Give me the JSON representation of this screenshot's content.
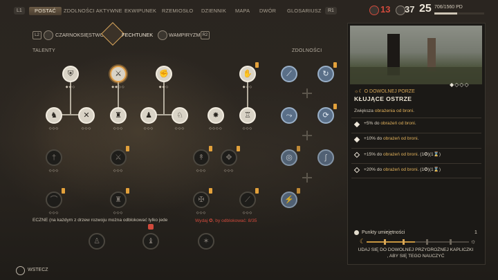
{
  "topbar": {
    "left_button": "L1",
    "right_button": "R1",
    "tabs": [
      {
        "label": "POSTAĆ",
        "active": true
      },
      {
        "label": "ZDOLNOŚCI AKTYWNE",
        "active": false
      },
      {
        "label": "EKWIPUNEK",
        "active": false
      },
      {
        "label": "RZEMIOSŁO",
        "active": false
      },
      {
        "label": "DZIENNIK",
        "active": false
      },
      {
        "label": "MAPA",
        "active": false
      },
      {
        "label": "DWÓR",
        "active": false
      },
      {
        "label": "GLOSARIUSZ",
        "active": false
      }
    ],
    "stats": {
      "red_value": "13",
      "gray_value": "37",
      "level": "25",
      "xp_text": "706/1560 PD",
      "xp_fraction": 0.4526
    },
    "colors": {
      "accent": "#d9a756",
      "alert": "#d14a3c"
    }
  },
  "schools": {
    "left_chip": "L2",
    "right_chip": "R2",
    "items": [
      {
        "label": "CZARNOKSIĘSTWO",
        "icon": "sorcery-icon"
      },
      {
        "label": "FECHTUNEK",
        "icon": "swordsmanship-icon",
        "active": true
      },
      {
        "label": "WAMPIRYZM",
        "icon": "vampirism-icon"
      }
    ]
  },
  "tree": {
    "talents_label": "TALENTY",
    "abilities_label": "ZDOLNOŚCI"
  },
  "footer": {
    "note": "ECZNE (na każdym z drzew rozwoju można odblokować tylko jede",
    "spend_prefix": "Wydaj",
    "spend_suffix": ", by odblokować: 8/35",
    "back_label": "WSTECZ"
  },
  "panel": {
    "diamonds": "◆◇◇◇",
    "subtitle": "☼☾ O DOWOLNEJ PORZE",
    "title": "KŁUJĄCE OSTRZE",
    "desc_prefix": "Zwiększa ",
    "desc_highlight": "obrażenia od broni",
    "desc_suffix": ".",
    "ranks": [
      {
        "amount": "+5% do ",
        "hl": "obrażeń od broni",
        "cost": ".",
        "filled": true
      },
      {
        "amount": "+10% do ",
        "hl": "obrażeń od broni",
        "cost": ".",
        "filled": true
      },
      {
        "amount": "+15% do ",
        "hl": "obrażeń od broni",
        "cost": ". (1✪)(1⌛)",
        "filled": false
      },
      {
        "amount": "+20% do ",
        "hl": "obrażeń od broni",
        "cost": ". (1✪)(1⌛)",
        "filled": false
      }
    ],
    "points_label": "Punkty umiejętności",
    "points_value": "1",
    "progress_fraction": 0.47,
    "footer_line1": "UDAJ SIĘ DO DOWOLNEJ PRZYDROŻNEJ KAPLICZKI",
    "footer_line2": ", ABY SIĘ TEGO NAUCZYĆ"
  }
}
